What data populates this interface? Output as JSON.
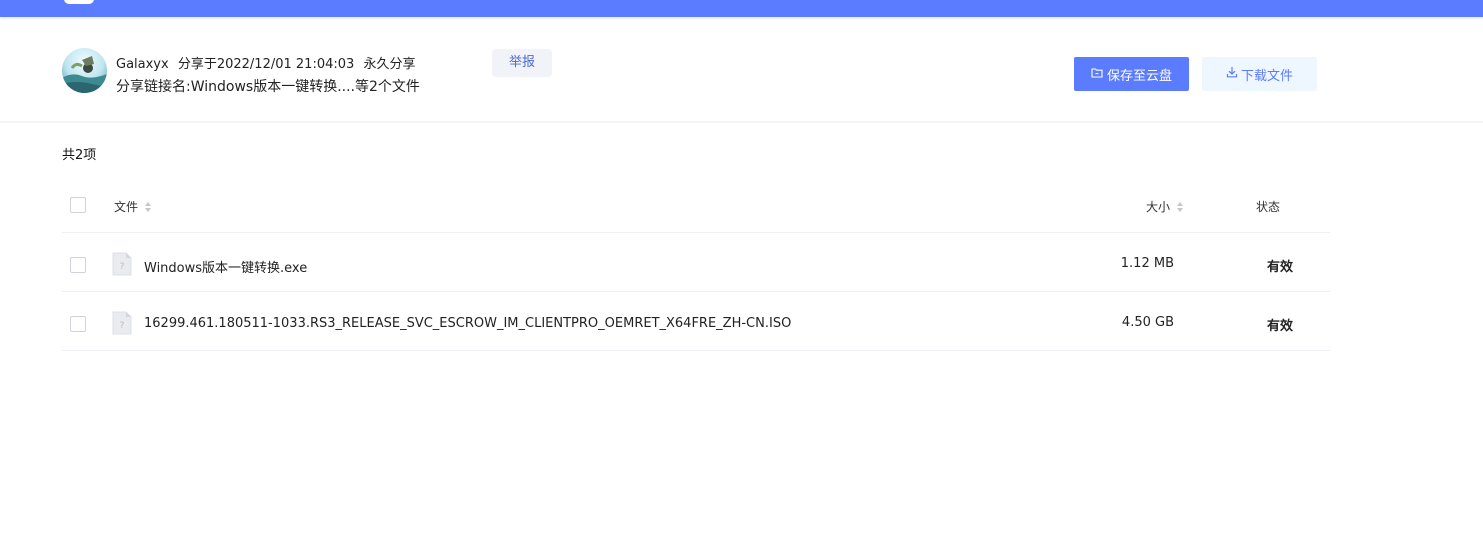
{
  "sharer": {
    "name": "Galaxyx",
    "share_time": "分享于2022/12/01 21:04:03",
    "validity": "永久分享",
    "share_name": "分享链接名:Windows版本一键转换....等2个文件"
  },
  "actions": {
    "report_label": "举报",
    "save_label": "保存至云盘",
    "download_label": "下载文件"
  },
  "list": {
    "total_label": "共2项",
    "headers": {
      "name": "文件",
      "size": "大小",
      "status": "状态"
    },
    "files": [
      {
        "name": "Windows版本一键转换.exe",
        "size": "1.12 MB",
        "status": "有效"
      },
      {
        "name": "16299.461.180511-1033.RS3_RELEASE_SVC_ESCROW_IM_CLIENTPRO_OEMRET_X64FRE_ZH-CN.ISO",
        "size": "4.50 GB",
        "status": "有效"
      }
    ]
  },
  "colors": {
    "brand": "#5b7cff",
    "report_text": "#4a6ad6",
    "download_bg": "#eef6ff"
  }
}
